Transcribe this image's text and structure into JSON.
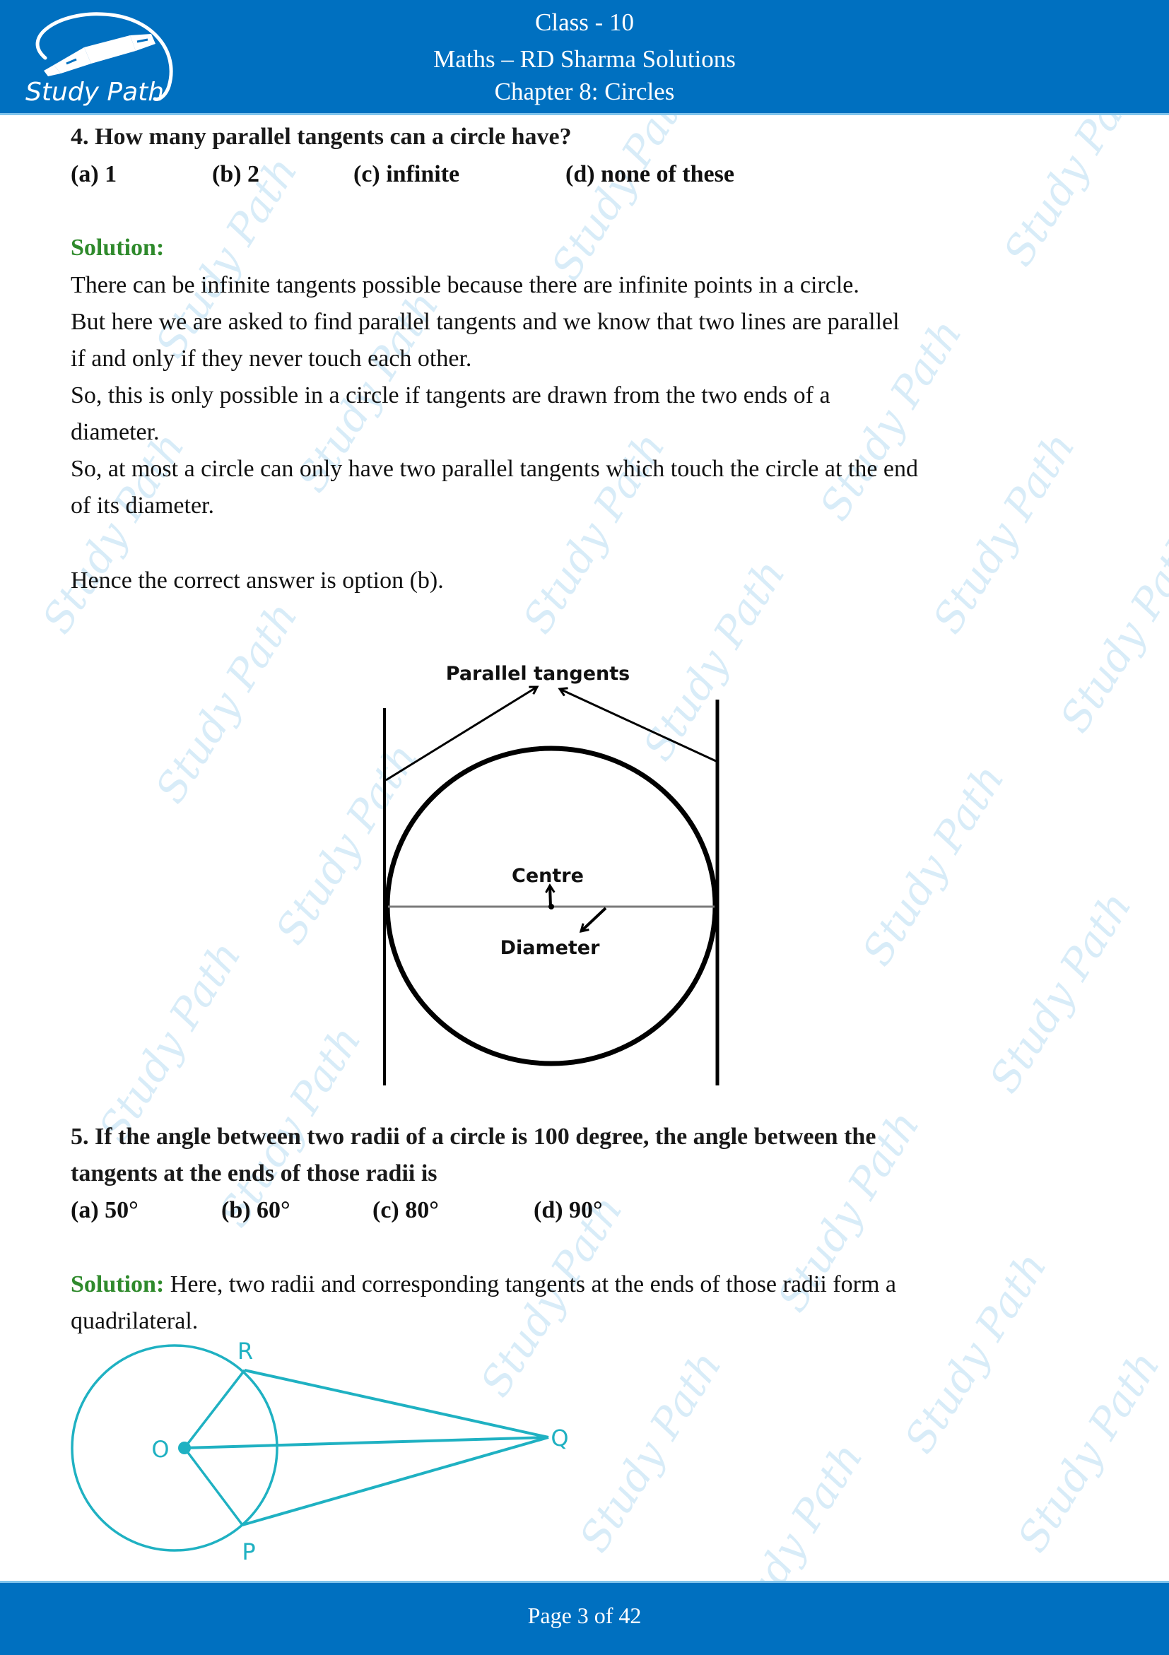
{
  "header": {
    "logo_text": "Study Path",
    "line1": "Class - 10",
    "line2": "Maths – RD Sharma Solutions",
    "line3": "Chapter 8: Circles",
    "background_color": "#0070c0"
  },
  "watermark_text": "Study Path",
  "question4": {
    "text": "4. How many parallel tangents can a circle have?",
    "options": [
      "(a) 1",
      "(b) 2",
      "(c) infinite",
      "(d) none of these"
    ],
    "solution_label": "Solution:",
    "solution_lines": [
      "There can be infinite tangents possible because there are infinite points in a circle.",
      "But here we are asked to find parallel tangents and we know that two lines are parallel",
      "if and only if they never touch each other.",
      "So, this is only possible in a circle if tangents are drawn from the two ends of a",
      "diameter.",
      "So, at most a circle can only have two parallel tangents which touch the circle at the end",
      "of its diameter."
    ],
    "conclusion": "Hence the correct answer is option (b).",
    "diagram": {
      "title_label": "Parallel tangents",
      "centre_label": "Centre",
      "diameter_label": "Diameter"
    }
  },
  "question5": {
    "text_line1": "5. If the angle between two radii of a circle is 100 degree, the angle between the",
    "text_line2": "tangents at the ends of those radii is",
    "options": [
      "(a) 50°",
      "(b) 60°",
      "(c) 80°",
      "(d) 90°"
    ],
    "solution_label": "Solution:",
    "solution_line1": " Here, two radii and corresponding tangents at the ends of those radii form a",
    "solution_line2": "quadrilateral.",
    "diagram": {
      "labels": {
        "R": "R",
        "O": "O",
        "Q": "Q",
        "P": "P"
      },
      "color": "#1fb1c2"
    }
  },
  "footer": {
    "page_label": "Page 3 of 42",
    "current_page": 3,
    "total_pages": 42
  },
  "colors": {
    "solution_green": "#2f8a2c",
    "watermark": "#d4ebf8"
  }
}
